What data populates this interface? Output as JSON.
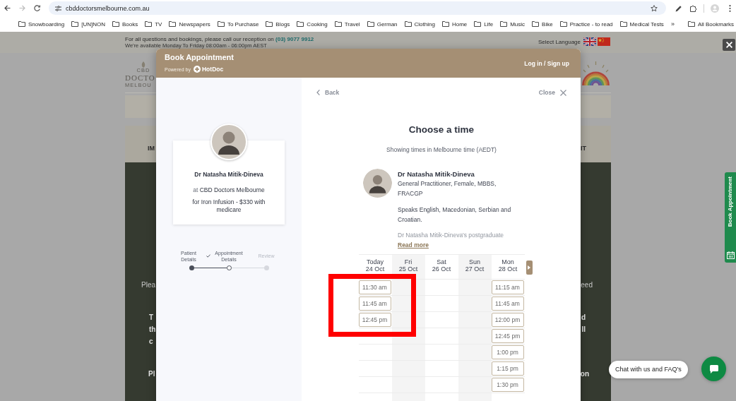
{
  "browser": {
    "can_go_forward": false,
    "address": "cbddoctorsmelbourne.com.au",
    "bookmarks": [
      "Snowboarding",
      "[UN]NON",
      "Books",
      "TV",
      "Newspapers",
      "To Purchase",
      "Blogs",
      "Cooking",
      "Travel",
      "German",
      "Clothing",
      "Home",
      "Life",
      "Music",
      "Bike",
      "Practice - to read",
      "Medical Tests"
    ],
    "more_bookmarks": "»",
    "all_bookmarks": "All Bookmarks"
  },
  "site": {
    "contact": "For all questions and bookings, please call our reception on **(03) 9077 9912**",
    "hours": "We're available Monday To Friday 08:00am - 06:00pm AEST",
    "language_label": "Select Language",
    "logo": {
      "tagline": "CBD",
      "name": "DOCTO",
      "location": "MELBOU"
    },
    "nav": {
      "left": "IM",
      "right": "IT"
    },
    "hero_paragraphs": [
      {
        "bold": false,
        "lines": [
          {
            "left": "Plea",
            "right": "eed"
          }
        ]
      },
      {
        "bold": true,
        "lines": [
          {
            "left": "T",
            "right": "d"
          },
          {
            "left": "th",
            "right": "ll"
          },
          {
            "left": "c"
          }
        ]
      },
      {
        "bold": true,
        "lines": [
          {
            "left": "Pl",
            "right": "on"
          }
        ]
      }
    ],
    "side_tab": "Book Appointment",
    "chat_prompt": "Chat with us and FAQ's"
  },
  "modal": {
    "title": "Book Appointment",
    "powered_by": "Powered by",
    "brand": "HotDoc",
    "login": "Log in / Sign up",
    "summary": {
      "doctor": "Dr Natasha Mitik-Dineva",
      "clinic": "at **CBD Doctors Melbourne**",
      "service": "for Iron Infusion - $330 with medicare"
    },
    "steps": [
      {
        "label": "Patient Details",
        "done": true,
        "current": false
      },
      {
        "label": "Appointment Details",
        "done": false,
        "current": true
      },
      {
        "label": "Review",
        "done": false,
        "current": false
      }
    ],
    "back": "Back",
    "close": "Close",
    "heading": "Choose a time",
    "timezone": "Showing times in Melbourne time (AEDT)",
    "doctor": {
      "name": "Dr Natasha Mitik-Dineva",
      "credentials": "General Practitioner, Female, MBBS, FRACGP",
      "languages": "Speaks English, Macedonian, Serbian and Croatian.",
      "bio": "Dr Natasha Mitik-Dineva's postgraduate",
      "read_more": "Read more"
    },
    "calendar": {
      "days": [
        {
          "day": "Today",
          "date": "24 Oct",
          "highlighted": true,
          "slots": [
            "11:30 am",
            "11:45 am",
            "12:45 pm"
          ]
        },
        {
          "day": "Fri",
          "date": "25 Oct",
          "highlighted": false
        },
        {
          "day": "Sat",
          "date": "26 Oct",
          "highlighted": false
        },
        {
          "day": "Sun",
          "date": "27 Oct",
          "highlighted": false
        },
        {
          "day": "Mon",
          "date": "28 Oct",
          "highlighted": false,
          "slots": [
            "11:15 am",
            "11:45 am",
            "12:00 pm",
            "12:45 pm",
            "1:00 pm",
            "1:15 pm",
            "1:30 pm"
          ]
        }
      ]
    }
  }
}
